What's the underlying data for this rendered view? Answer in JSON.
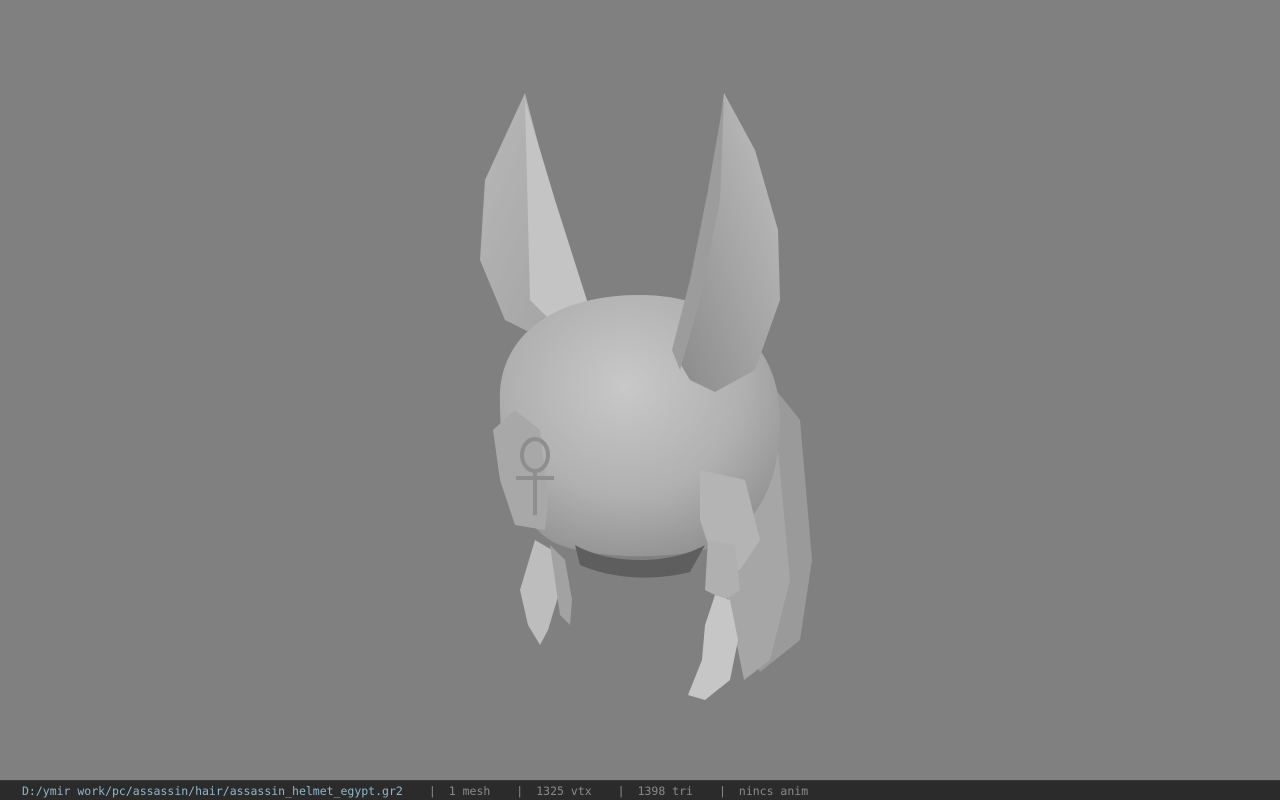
{
  "viewport": {
    "background": "#808080",
    "model": {
      "icon": "helmet-model",
      "description_visible": false
    }
  },
  "statusbar": {
    "path": "D:/ymir work/pc/assassin/hair/assassin_helmet_egypt.gr2",
    "separator": "|",
    "mesh": "1 mesh",
    "vertices": "1325 vtx",
    "triangles": "1398 tri",
    "animation": "nincs anim",
    "colors": {
      "background": "#2b2b2b",
      "path": "#8fb6c9",
      "text": "#8a8a8a"
    }
  }
}
